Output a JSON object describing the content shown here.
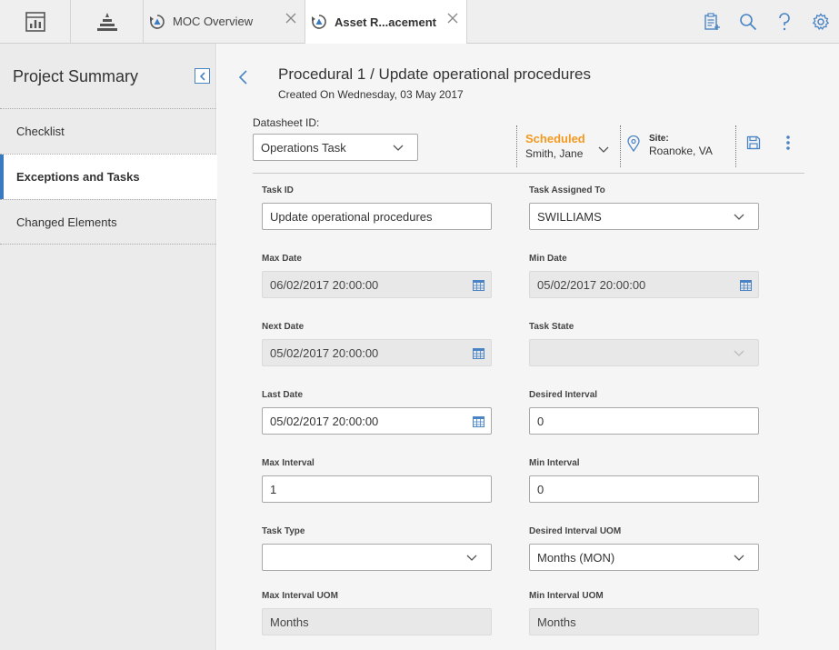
{
  "topbar": {
    "icon_tabs": [
      {
        "name": "dashboard-icon"
      },
      {
        "name": "hierarchy-icon"
      }
    ],
    "tabs": [
      {
        "label": "MOC Overview",
        "icon": "moc-refresh-icon",
        "active": false
      },
      {
        "label": "Asset R...acement",
        "icon": "moc-refresh-icon",
        "active": true
      }
    ],
    "actions": [
      {
        "name": "clipboard-add-icon"
      },
      {
        "name": "search-icon"
      },
      {
        "name": "help-icon"
      },
      {
        "name": "gear-icon"
      }
    ]
  },
  "sidebar": {
    "title": "Project Summary",
    "items": [
      {
        "label": "Checklist",
        "active": false
      },
      {
        "label": "Exceptions and Tasks",
        "active": true
      },
      {
        "label": "Changed Elements",
        "active": false
      }
    ]
  },
  "header": {
    "title": "Procedural 1 / Update operational procedures",
    "subtitle": "Created On Wednesday, 03 May 2017"
  },
  "datasheet": {
    "label": "Datasheet ID:",
    "value": "Operations Task"
  },
  "state": {
    "label": "Scheduled",
    "owner": "Smith, Jane",
    "color": "#f39a1e"
  },
  "site": {
    "key": "Site:",
    "value": "Roanoke, VA"
  },
  "form": {
    "task_id": {
      "label": "Task ID",
      "value": "Update operational procedures"
    },
    "task_assigned_to": {
      "label": "Task Assigned To",
      "value": "SWILLIAMS"
    },
    "max_date": {
      "label": "Max Date",
      "value": "06/02/2017 20:00:00"
    },
    "min_date": {
      "label": "Min Date",
      "value": "05/02/2017 20:00:00"
    },
    "next_date": {
      "label": "Next Date",
      "value": "05/02/2017 20:00:00"
    },
    "task_state": {
      "label": "Task State",
      "value": ""
    },
    "last_date": {
      "label": "Last Date",
      "value": "05/02/2017 20:00:00"
    },
    "desired_interval": {
      "label": "Desired Interval",
      "value": "0"
    },
    "max_interval": {
      "label": "Max Interval",
      "value": "1"
    },
    "min_interval": {
      "label": "Min Interval",
      "value": "0"
    },
    "task_type": {
      "label": "Task Type",
      "value": ""
    },
    "desired_interval_uom": {
      "label": "Desired Interval UOM",
      "value": "Months (MON)"
    },
    "max_interval_uom": {
      "label": "Max Interval UOM",
      "value": "Months"
    },
    "min_interval_uom": {
      "label": "Min Interval UOM",
      "value": "Months"
    }
  },
  "colors": {
    "accent": "#3a7ac0",
    "scheduled": "#f39a1e"
  }
}
